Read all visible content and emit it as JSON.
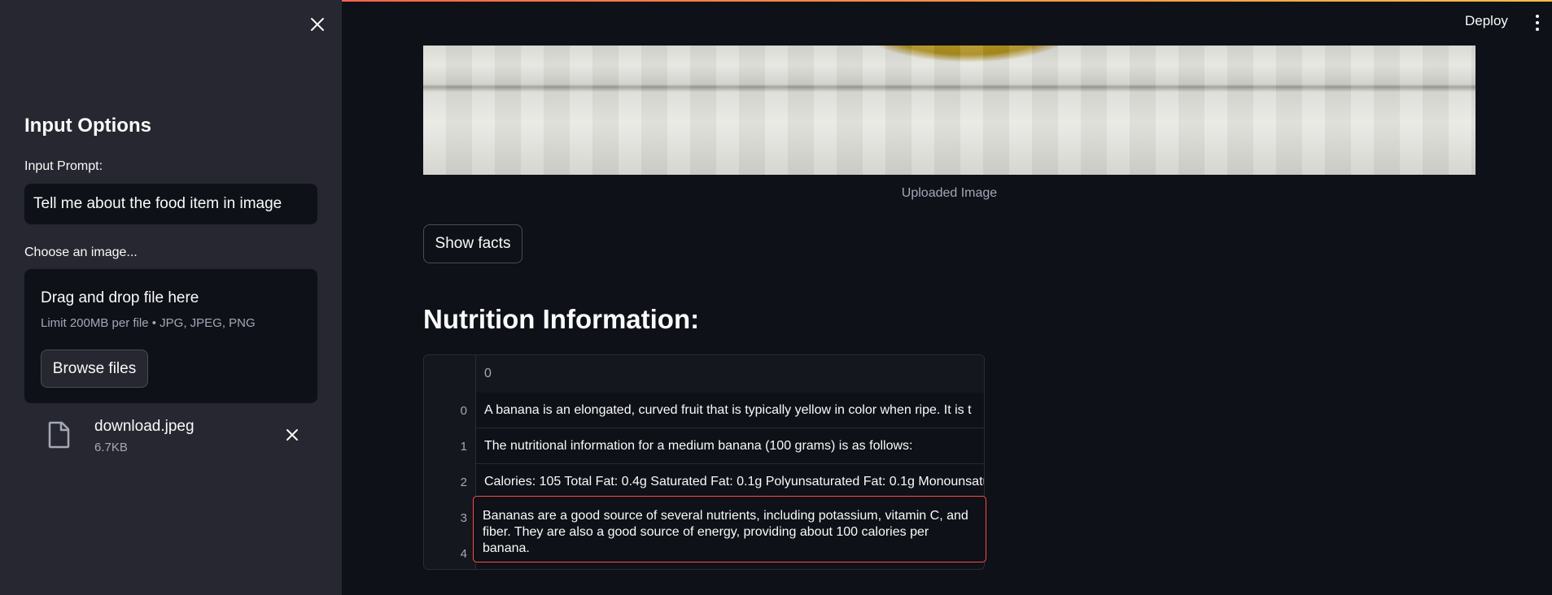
{
  "sidebar": {
    "title": "Input Options",
    "prompt_label": "Input Prompt:",
    "prompt_value": "Tell me about the food item in image",
    "uploader_label": "Choose an image...",
    "dropzone": {
      "title": "Drag and drop file here",
      "limits": "Limit 200MB per file • JPG, JPEG, PNG",
      "browse_label": "Browse files"
    },
    "file": {
      "name": "download.jpeg",
      "size": "6.7KB"
    }
  },
  "header": {
    "deploy_label": "Deploy"
  },
  "main": {
    "image_caption": "Uploaded Image",
    "show_facts_label": "Show facts",
    "section_title": "Nutrition Information:",
    "table": {
      "column_header": "0",
      "rows": [
        {
          "index": "0",
          "value": "A banana is an elongated, curved fruit that is typically yellow in color when ripe. It is t"
        },
        {
          "index": "1",
          "value": "The nutritional information for a medium banana (100 grams) is as follows:"
        },
        {
          "index": "2",
          "value": "Calories: 105 Total Fat: 0.4g Saturated Fat: 0.1g Polyunsaturated Fat: 0.1g Monounsatu"
        },
        {
          "index": "3",
          "value": ""
        },
        {
          "index": "4",
          "value": ""
        }
      ],
      "expanded_cell": "Bananas are a good source of several nutrients, including potassium, vitamin C, and fiber. They are also a good source of energy, providing about 100 calories per banana."
    }
  }
}
